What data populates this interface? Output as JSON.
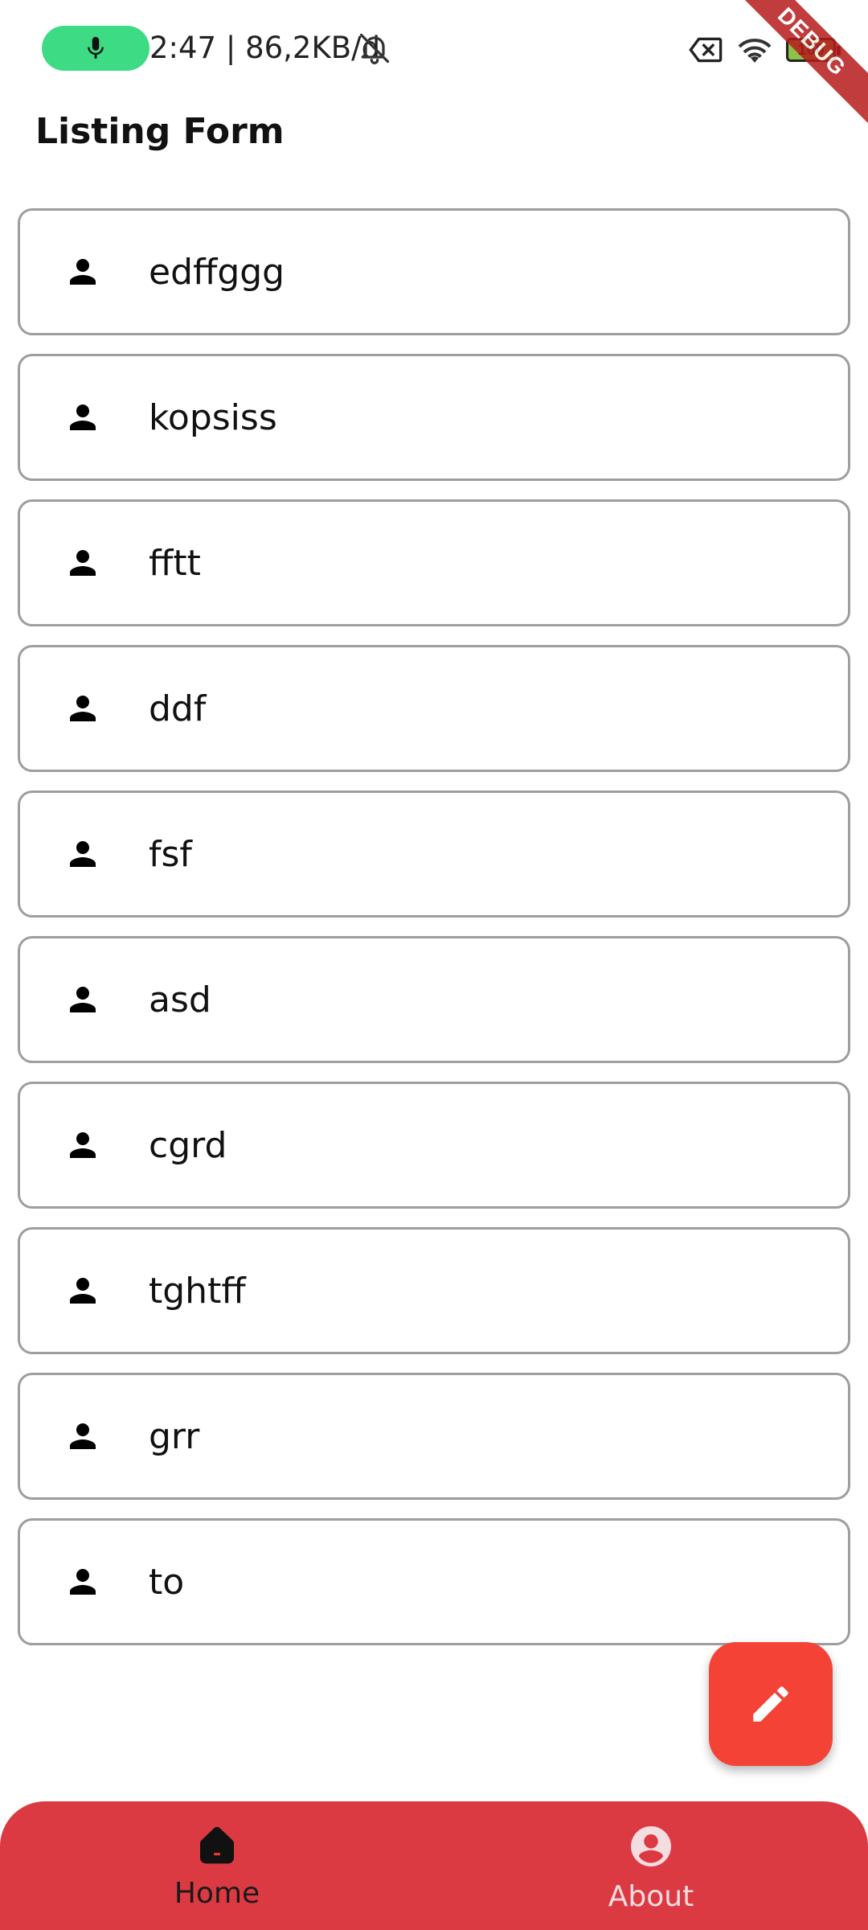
{
  "status_bar": {
    "time_info": "2:47 | 86,2KB/d",
    "battery": "100"
  },
  "debug_ribbon": "DEBUG",
  "app_bar": {
    "title": "Listing Form"
  },
  "list": {
    "items": [
      {
        "label": "edffggg",
        "icon": "person-icon"
      },
      {
        "label": "kopsiss",
        "icon": "person-icon"
      },
      {
        "label": "fftt",
        "icon": "person-icon"
      },
      {
        "label": "ddf",
        "icon": "person-icon"
      },
      {
        "label": "fsf",
        "icon": "person-icon"
      },
      {
        "label": "asd",
        "icon": "person-icon"
      },
      {
        "label": "cgrd",
        "icon": "person-icon"
      },
      {
        "label": "tghtff",
        "icon": "person-icon"
      },
      {
        "label": "grr",
        "icon": "person-icon"
      },
      {
        "label": "to",
        "icon": "person-icon"
      }
    ]
  },
  "fab": {
    "icon": "edit-icon"
  },
  "bottom_nav": {
    "items": [
      {
        "label": "Home",
        "icon": "home-icon",
        "selected": true
      },
      {
        "label": "About",
        "icon": "account-circle-icon",
        "selected": false
      }
    ]
  },
  "colors": {
    "accent_red": "#dc3a42",
    "fab_red": "#f44336",
    "mic_green": "#3ddc84",
    "border_gray": "#9e9e9e"
  }
}
